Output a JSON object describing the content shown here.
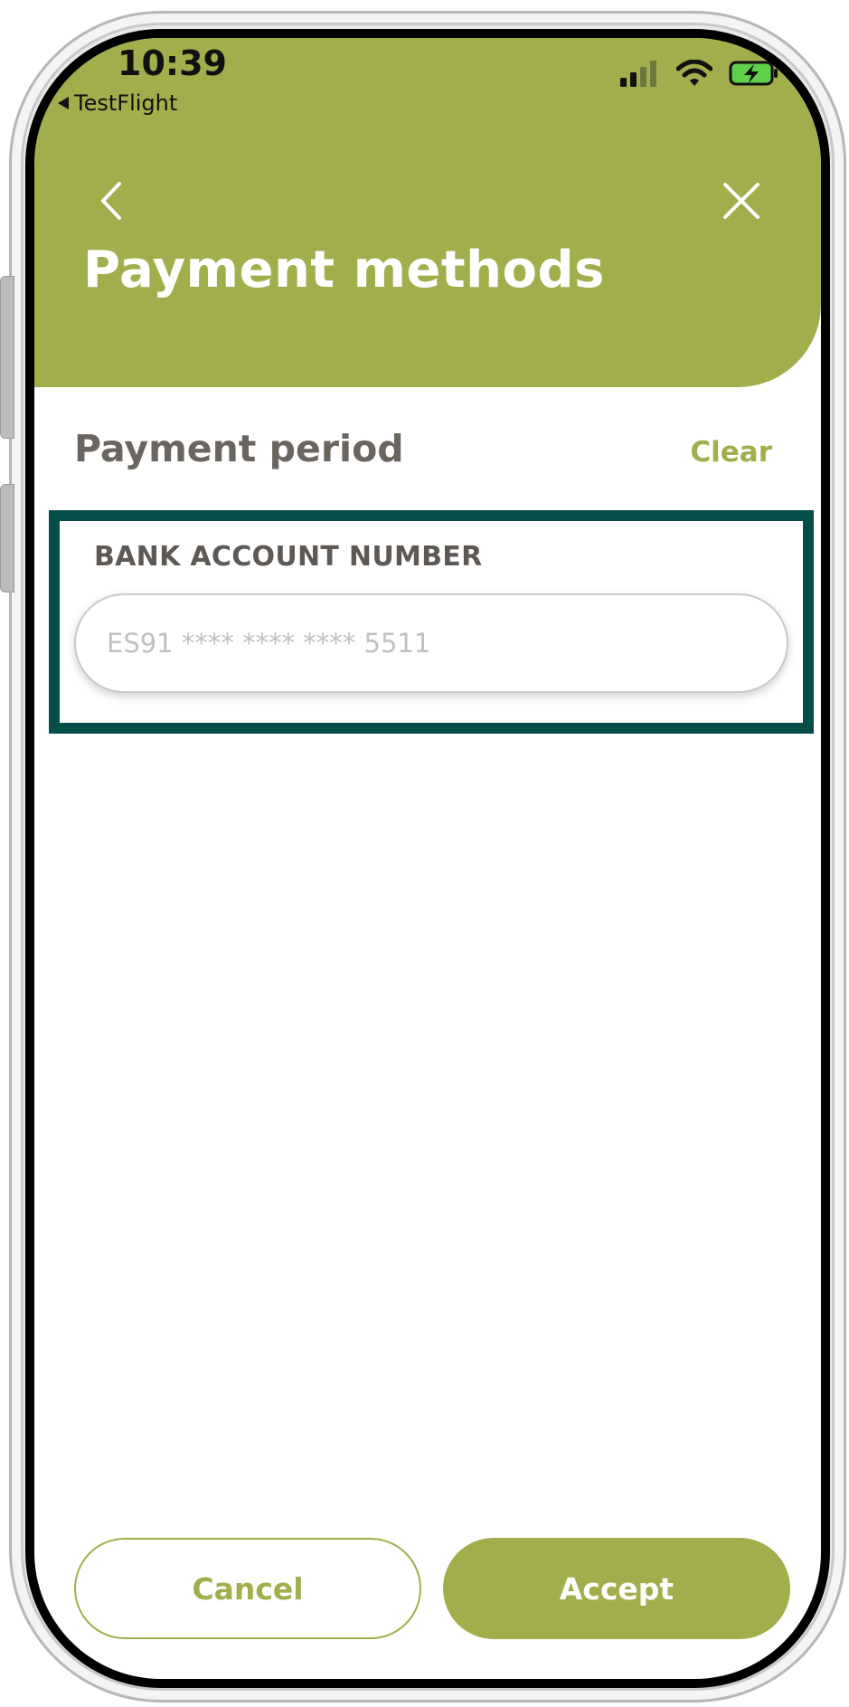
{
  "status_bar": {
    "time": "10:39",
    "back_app": "TestFlight",
    "icons": [
      "cellular-signal-icon",
      "wifi-icon",
      "battery-charging-icon"
    ]
  },
  "header": {
    "title": "Payment methods",
    "back_icon": "chevron-left-icon",
    "close_icon": "close-icon"
  },
  "section": {
    "title": "Payment period",
    "clear_label": "Clear"
  },
  "bank_account": {
    "label": "BANK ACCOUNT NUMBER",
    "value": "",
    "placeholder": "ES91 **** **** **** 5511"
  },
  "footer": {
    "cancel_label": "Cancel",
    "accept_label": "Accept"
  },
  "colors": {
    "brand_green": "#a2ad4b",
    "highlight_teal": "#064e4a",
    "heading_gray": "#6b6560",
    "white": "#ffffff"
  }
}
